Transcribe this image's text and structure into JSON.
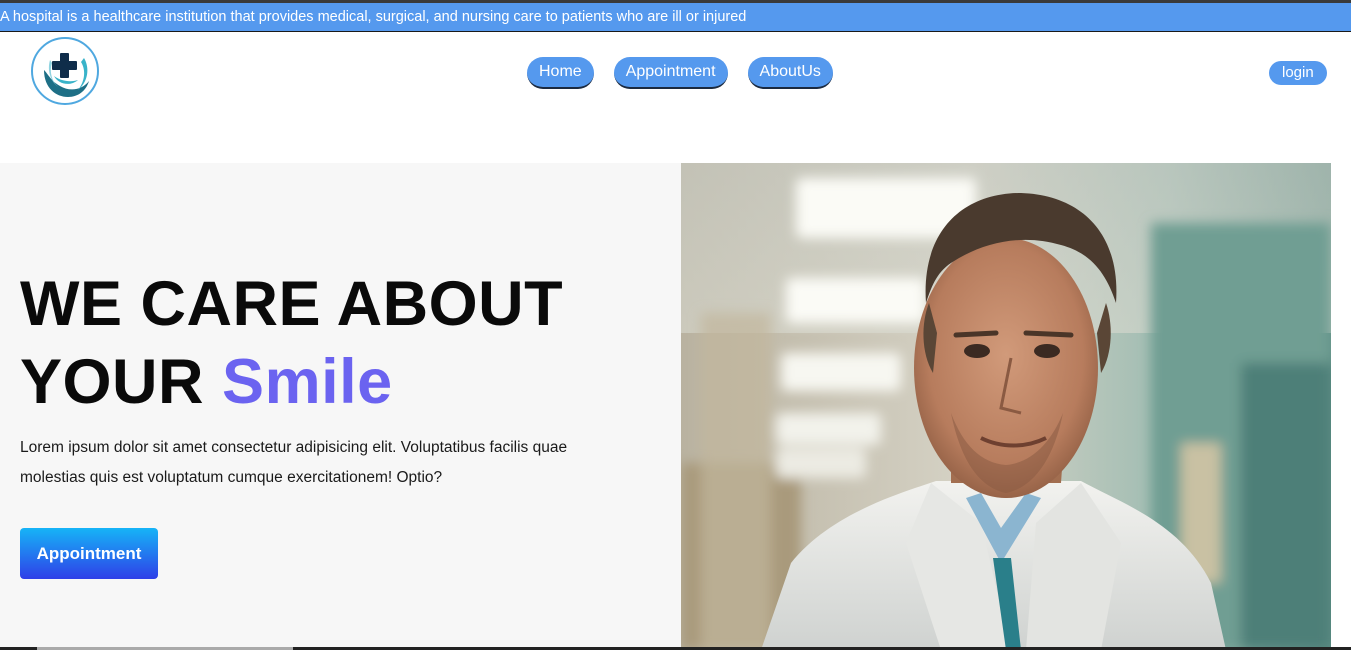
{
  "marquee": {
    "text": "A hospital is a healthcare institution that provides medical, surgical, and nursing care to patients who are ill or injured"
  },
  "nav": {
    "logo_icon": "medical-cross-hands-icon",
    "links": [
      {
        "label": "Home"
      },
      {
        "label": "Appointment"
      },
      {
        "label": "AboutUs"
      }
    ],
    "login_label": "login"
  },
  "hero": {
    "headline_line1": "WE CARE ABOUT",
    "headline_word": "YOUR",
    "headline_accent": "Smile",
    "lead": "Lorem ipsum dolor sit amet consectetur adipisicing elit. Voluptatibus facilis quae molestias quis est voluptatum cumque exercitationem! Optio?",
    "cta_label": "Appointment",
    "photo": "doctor-portrait"
  },
  "colors": {
    "nav_blue": "#5599ee",
    "accent_purple": "#6b63f0",
    "cta_gradient_top": "#16b4f7",
    "cta_gradient_bottom": "#2f3fe8"
  }
}
